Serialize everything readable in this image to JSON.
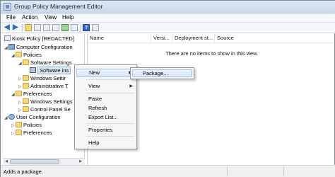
{
  "window": {
    "title": "Group Policy Management Editor"
  },
  "menu": [
    "File",
    "Action",
    "View",
    "Help"
  ],
  "toolbar": {
    "help_label": "?"
  },
  "tree": [
    {
      "label": "Kiosk Policy [REDACTED]"
    },
    {
      "label": "Computer Configuration"
    },
    {
      "label": "Policies"
    },
    {
      "label": "Software Settings"
    },
    {
      "label": "Software ins"
    },
    {
      "label": "Windows Settir"
    },
    {
      "label": "Administrative T"
    },
    {
      "label": "Preferences"
    },
    {
      "label": "Windows Settings"
    },
    {
      "label": "Control Panel Se"
    },
    {
      "label": "User Configuration"
    },
    {
      "label": "Policies"
    },
    {
      "label": "Preferences"
    }
  ],
  "list": {
    "columns": [
      "Name",
      "Versi...",
      "Deployment st...",
      "Source"
    ],
    "empty_message": "There are no items to show in this view."
  },
  "context_menu": {
    "items": [
      "New",
      "View",
      "Paste",
      "Refresh",
      "Export List...",
      "Properties",
      "Help"
    ]
  },
  "submenu": {
    "items": [
      "Package..."
    ]
  },
  "status": {
    "text": "Adds a package."
  }
}
